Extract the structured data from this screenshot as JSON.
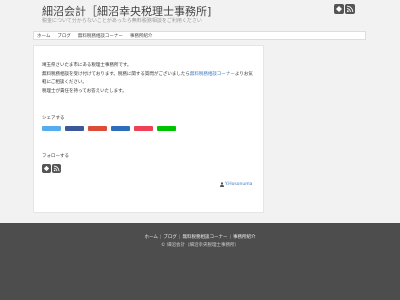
{
  "site": {
    "title": "細沼会計［細沼幸央税理士事務所]",
    "description": "税金について分からないことがあったら無料税務相談をご利用ください"
  },
  "nav": {
    "items": [
      "ホーム",
      "ブログ",
      "無料税務相談コーナー",
      "事務所紹介"
    ]
  },
  "main": {
    "text_line1": "埼玉県さいたま市にある税理士事務所です。",
    "text_line2_before": "無料税務相談を受け付けております。税務に関する質問がございましたら",
    "text_line2_link": "無料税務相談コーナー",
    "text_line3_tail": "よりお気軽にご相談ください。",
    "text_line4": "税理士が責任を持ってお答えいたします。",
    "share_title": "シェアする",
    "follow_title": "フォローする",
    "author_name": "Y.Hosonuma"
  },
  "share_buttons": [
    {
      "name": "twitter",
      "color": "#55acee"
    },
    {
      "name": "facebook",
      "color": "#3b5998"
    },
    {
      "name": "google-plus",
      "color": "#dd4b39"
    },
    {
      "name": "hatena",
      "color": "#2c6ebd"
    },
    {
      "name": "pocket",
      "color": "#ef4056"
    },
    {
      "name": "line",
      "color": "#00c300"
    }
  ],
  "footer": {
    "nav_items": [
      "ホーム",
      "ブログ",
      "無料税務相談コーナー",
      "事務所紹介"
    ],
    "copyright": "© 細沼会計（細沼幸央税理士事務所）"
  },
  "colors": {
    "accent_link": "#3a78c3",
    "footer_bg": "#4d4d4d",
    "icon_bg": "#555555"
  }
}
